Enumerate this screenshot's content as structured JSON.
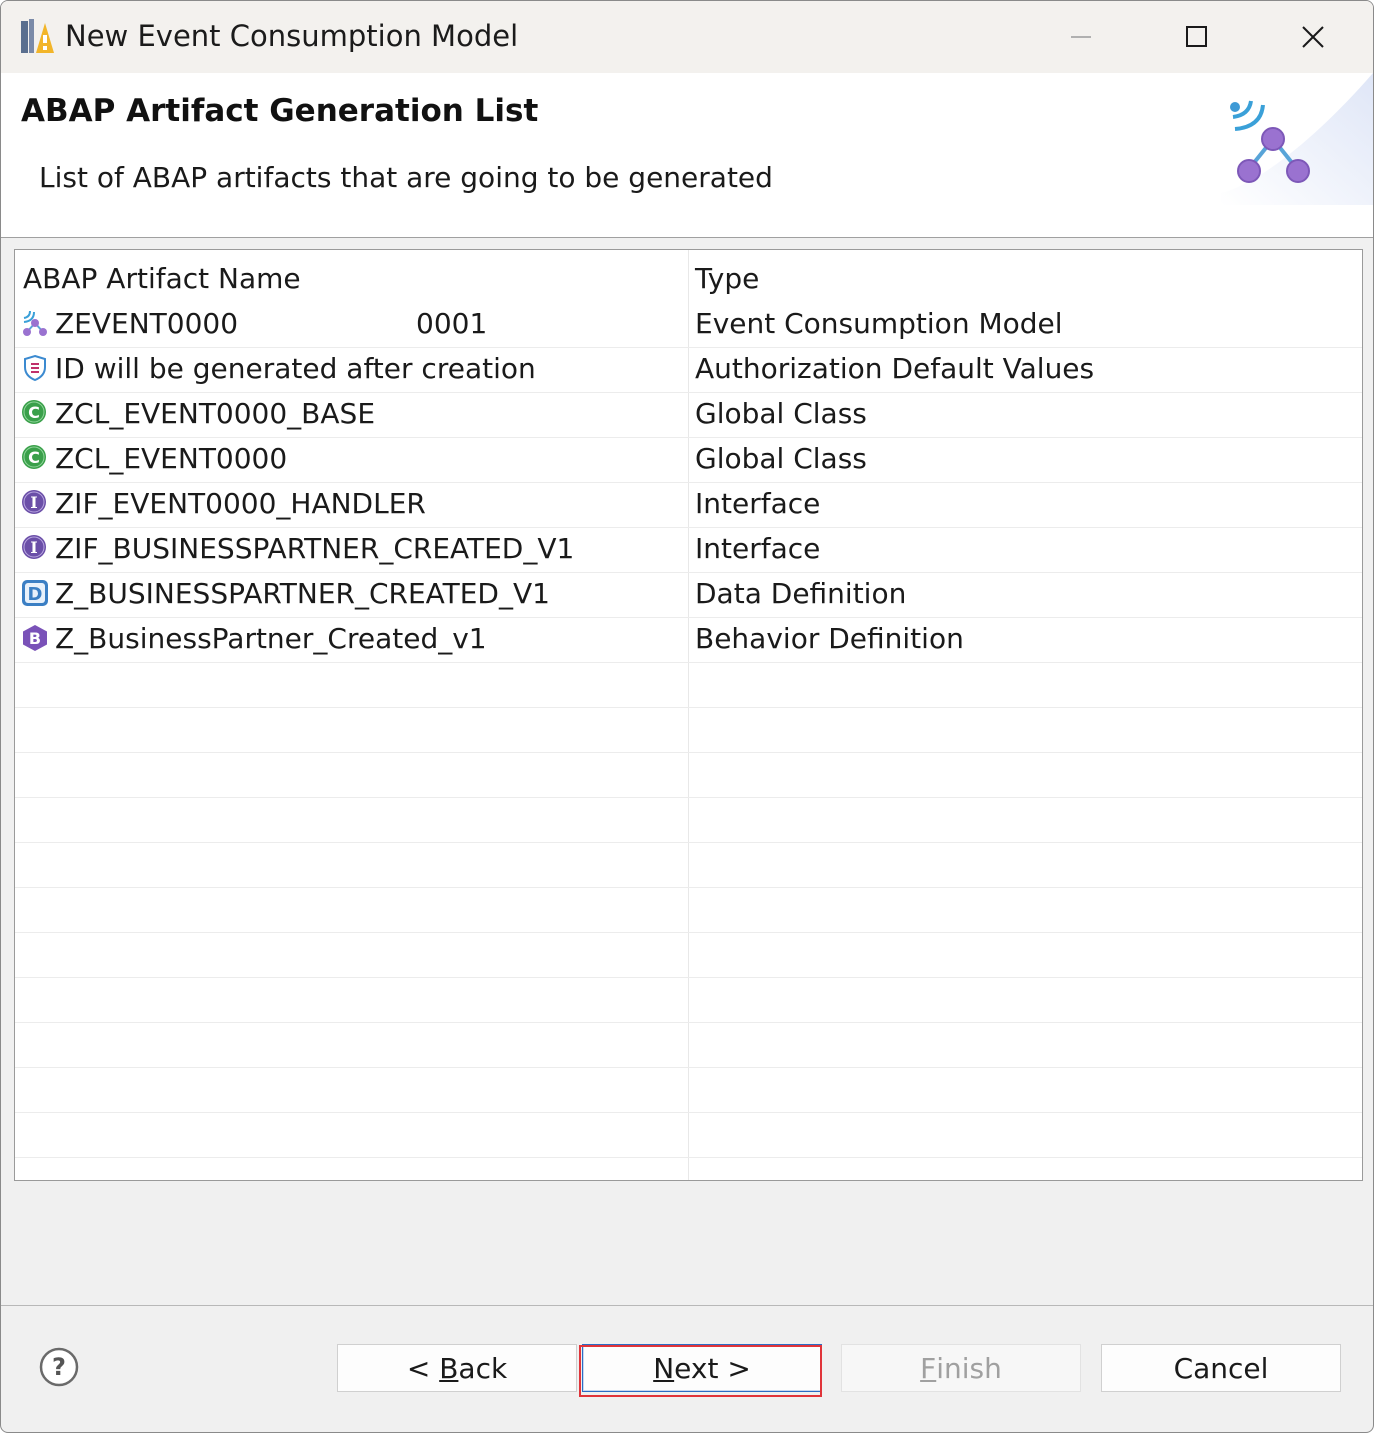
{
  "window": {
    "title": "New Event Consumption Model",
    "app_icon": "eclipse-abap-icon",
    "controls": [
      "minimize-icon",
      "maximize-icon",
      "close-icon"
    ]
  },
  "banner": {
    "title": "ABAP Artifact Generation List",
    "description": "List of ABAP artifacts that are going to be generated",
    "graphic": "event-network-icon"
  },
  "table": {
    "columns": [
      "ABAP Artifact Name",
      "Type"
    ],
    "rows": [
      {
        "icon": "event-consumption-model-icon",
        "name": "ZEVENT0000                    0001",
        "type": "Event Consumption Model"
      },
      {
        "icon": "authorization-shield-icon",
        "name": "ID will be generated after creation",
        "type": "Authorization Default Values"
      },
      {
        "icon": "global-class-icon",
        "name": "ZCL_EVENT0000_BASE",
        "type": "Global Class"
      },
      {
        "icon": "global-class-icon",
        "name": "ZCL_EVENT0000",
        "type": "Global Class"
      },
      {
        "icon": "interface-icon",
        "name": "ZIF_EVENT0000_HANDLER",
        "type": "Interface"
      },
      {
        "icon": "interface-icon",
        "name": "ZIF_BUSINESSPARTNER_CREATED_V1",
        "type": "Interface"
      },
      {
        "icon": "data-definition-icon",
        "name": "Z_BUSINESSPARTNER_CREATED_V1",
        "type": "Data Definition"
      },
      {
        "icon": "behavior-definition-icon",
        "name": "Z_BusinessPartner_Created_v1",
        "type": "Behavior Definition"
      }
    ]
  },
  "buttons": {
    "help_icon": "help-icon",
    "back": {
      "prefix": "< ",
      "mnemonic": "B",
      "rest": "ack"
    },
    "next": {
      "mnemonic": "N",
      "rest": "ext >"
    },
    "finish": {
      "mnemonic": "F",
      "rest": "inish"
    },
    "cancel": "Cancel"
  },
  "colors": {
    "highlight": "#e0343a",
    "class_green": "#3aa04a",
    "interface_purple": "#6b4fa8",
    "data_def_blue": "#3b7fc4",
    "behavior_purple": "#7a52b8"
  }
}
